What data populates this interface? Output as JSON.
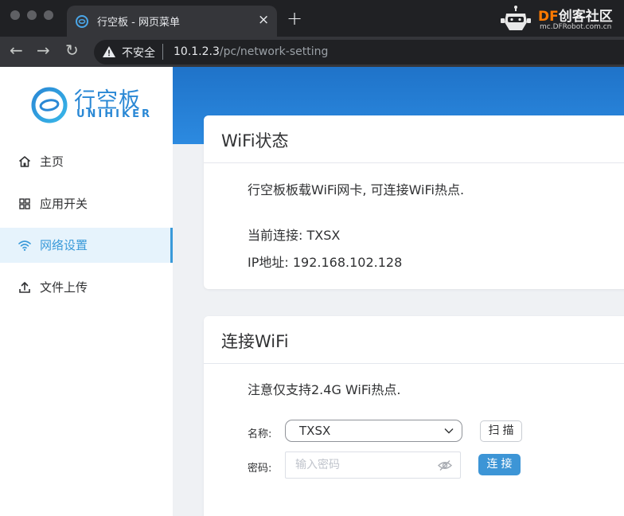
{
  "browser": {
    "tab_title": "行空板 - 网页菜单",
    "tab_close": "×",
    "new_tab": "+",
    "security_label": "不安全",
    "url_host": "10.1.2.3",
    "url_path": "/pc/network-setting",
    "watermark_title_accent": "DF",
    "watermark_title_rest": "创客社区",
    "watermark_sub": "mc.DFRobot.com.cn"
  },
  "sidebar": {
    "logo_cn": "行空板",
    "logo_en": "UNIHIKER",
    "items": [
      {
        "label": "主页",
        "icon": "home-icon",
        "active": false
      },
      {
        "label": "应用开关",
        "icon": "grid-icon",
        "active": false
      },
      {
        "label": "网络设置",
        "icon": "wifi-icon",
        "active": true
      },
      {
        "label": "文件上传",
        "icon": "upload-icon",
        "active": false
      }
    ]
  },
  "wifi_status": {
    "title": "WiFi状态",
    "description": "行空板板载WiFi网卡, 可连接WiFi热点.",
    "current_connection": "当前连接: TXSX",
    "ip_address": "IP地址: 192.168.102.128"
  },
  "connect_wifi": {
    "title": "连接WiFi",
    "note": "注意仅支持2.4G WiFi热点.",
    "name_label": "名称:",
    "ssid_value": "TXSX",
    "scan_button": "扫描",
    "password_label": "密码:",
    "password_placeholder": "输入密码",
    "connect_button": "连接"
  },
  "colors": {
    "accent": "#3a9ad9",
    "banner": "#2c8ae0",
    "brand_blue": "#2a88d5"
  }
}
